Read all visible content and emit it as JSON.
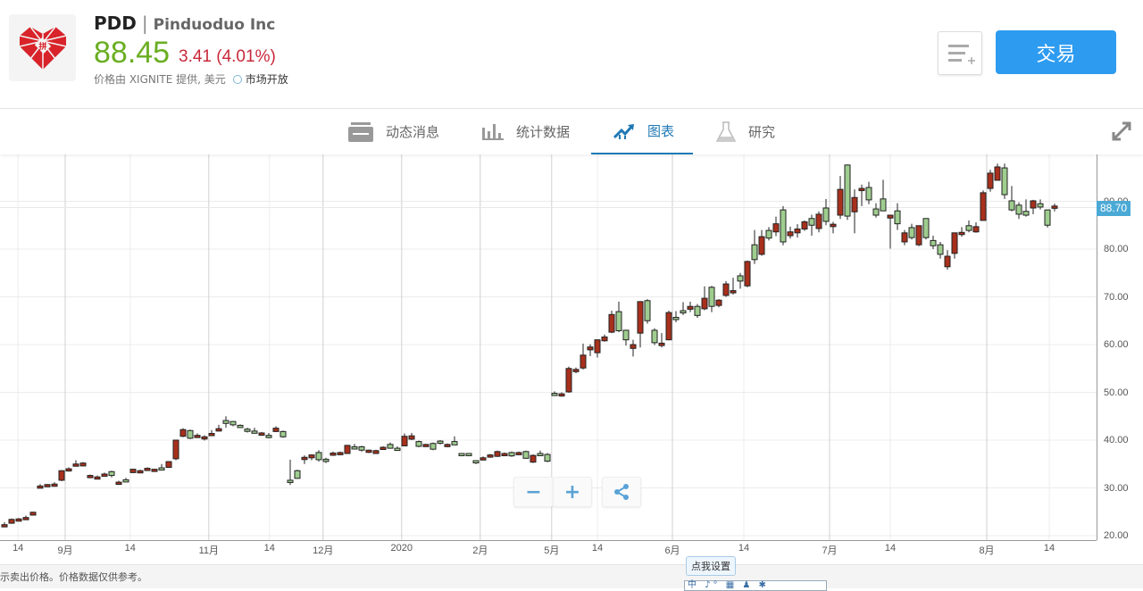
{
  "header": {
    "ticker": "PDD",
    "separator": "|",
    "company": "Pinduoduo Inc",
    "price": "88.45",
    "change": "3.41 (4.01%)",
    "source": "价格由 XIGNITE 提供, 美元",
    "market_status": "市场开放",
    "trade_label": "交易",
    "colors": {
      "price": "#6aae22",
      "change": "#c8283a",
      "trade": "#2d9bf0"
    }
  },
  "tabs": [
    {
      "label": "动态消息",
      "icon": "news-icon"
    },
    {
      "label": "统计数据",
      "icon": "bar-stats-icon"
    },
    {
      "label": "图表",
      "icon": "chart-trend-icon",
      "active": true
    },
    {
      "label": "研究",
      "icon": "flask-icon"
    }
  ],
  "controls": {
    "zoom_out": "−",
    "zoom_in": "+"
  },
  "footer": {
    "disclaimer": "示卖出价格。价格数据仅供参考。",
    "tooltip": "点我设置",
    "ime_toolbar": "中 ♪° ▦ ♟ ✱"
  },
  "chart_data": {
    "type": "candlestick",
    "ylim": [
      20,
      99.4
    ],
    "yticks": [
      "20.00",
      "30.00",
      "40.00",
      "50.00",
      "60.00",
      "70.00",
      "80.00",
      "90.00"
    ],
    "ytick_values": [
      20,
      30,
      40,
      50,
      60,
      70,
      80,
      90
    ],
    "last_price": "88.70",
    "last_price_value": 88.7,
    "xticks": [
      {
        "label": "14",
        "index": 1.9,
        "major": false
      },
      {
        "label": "9月",
        "index": 8.5,
        "major": true
      },
      {
        "label": "14",
        "index": 17.6,
        "major": false
      },
      {
        "label": "11月",
        "index": 28.6,
        "major": true
      },
      {
        "label": "14",
        "index": 37.1,
        "major": false
      },
      {
        "label": "12月",
        "index": 44.6,
        "major": true
      },
      {
        "label": "2020",
        "index": 55.6,
        "major": true
      },
      {
        "label": "2月",
        "index": 66.6,
        "major": true
      },
      {
        "label": "5月",
        "index": 76.6,
        "major": true
      },
      {
        "label": "14",
        "index": 83,
        "major": false
      },
      {
        "label": "6月",
        "index": 93.5,
        "major": true
      },
      {
        "label": "14",
        "index": 103.5,
        "major": false
      },
      {
        "label": "7月",
        "index": 115.5,
        "major": true
      },
      {
        "label": "14",
        "index": 124,
        "major": false
      },
      {
        "label": "8月",
        "index": 137.5,
        "major": true
      },
      {
        "label": "14",
        "index": 146.25,
        "major": false
      }
    ],
    "up_color": "#a8301c",
    "down_color": "#9fcd8f",
    "ohlc": [
      [
        22.0,
        22.8,
        21.8,
        22.3
      ],
      [
        22.6,
        23.6,
        22.5,
        23.4
      ],
      [
        23.2,
        23.7,
        23.0,
        23.5
      ],
      [
        23.5,
        24.2,
        23.4,
        23.8
      ],
      [
        24.3,
        25.0,
        24.2,
        24.9
      ],
      [
        30.1,
        30.8,
        30.0,
        30.4
      ],
      [
        30.5,
        30.8,
        30.4,
        30.7
      ],
      [
        30.5,
        31.2,
        30.4,
        30.8
      ],
      [
        31.6,
        33.7,
        31.4,
        33.6
      ],
      [
        33.6,
        34.3,
        33.4,
        34.0
      ],
      [
        34.6,
        35.8,
        34.5,
        35.0
      ],
      [
        34.6,
        35.4,
        34.5,
        35.2
      ],
      [
        32.3,
        32.8,
        32.2,
        32.6
      ],
      [
        32.0,
        32.6,
        31.9,
        32.3
      ],
      [
        32.6,
        33.2,
        32.5,
        32.9
      ],
      [
        33.4,
        33.6,
        32.2,
        32.6
      ],
      [
        30.8,
        31.5,
        30.7,
        31.2
      ],
      [
        31.7,
        32.1,
        31.3,
        31.4
      ],
      [
        33.2,
        34.0,
        33.1,
        33.9
      ],
      [
        33.2,
        33.8,
        33.1,
        33.6
      ],
      [
        33.9,
        34.3,
        33.8,
        34.1
      ],
      [
        33.7,
        34.0,
        33.6,
        33.9
      ],
      [
        34.2,
        35.0,
        33.9,
        33.9
      ],
      [
        34.3,
        35.6,
        34.2,
        35.5
      ],
      [
        36.1,
        40.1,
        35.8,
        40.0
      ],
      [
        40.8,
        42.5,
        40.6,
        42.2
      ],
      [
        42.0,
        42.2,
        40.2,
        40.4
      ],
      [
        40.6,
        41.4,
        40.5,
        41.0
      ],
      [
        40.4,
        41.0,
        39.9,
        40.7
      ],
      [
        41.1,
        42.1,
        40.9,
        41.4
      ],
      [
        41.9,
        43.2,
        41.8,
        42.4
      ],
      [
        44.1,
        45.0,
        42.6,
        43.5
      ],
      [
        43.9,
        44.0,
        42.9,
        43.2
      ],
      [
        43.1,
        43.3,
        42.7,
        42.9
      ],
      [
        42.3,
        42.6,
        41.6,
        41.9
      ],
      [
        41.9,
        42.6,
        41.4,
        41.6
      ],
      [
        41.2,
        41.7,
        40.9,
        41.5
      ],
      [
        41.0,
        41.5,
        40.4,
        40.9
      ],
      [
        41.8,
        42.9,
        41.7,
        42.5
      ],
      [
        41.8,
        42.0,
        40.5,
        40.7
      ],
      [
        31.6,
        35.9,
        30.6,
        31.2
      ],
      [
        33.6,
        33.8,
        31.9,
        32.0
      ],
      [
        36.1,
        36.8,
        35.0,
        36.4
      ],
      [
        36.3,
        37.0,
        35.8,
        36.9
      ],
      [
        37.4,
        37.9,
        35.5,
        35.9
      ],
      [
        36.0,
        36.3,
        35.2,
        35.7
      ],
      [
        36.9,
        37.6,
        36.7,
        37.3
      ],
      [
        37.2,
        37.6,
        36.9,
        37.4
      ],
      [
        37.2,
        39.0,
        37.1,
        38.9
      ],
      [
        38.6,
        39.2,
        38.1,
        38.3
      ],
      [
        38.6,
        38.8,
        37.6,
        37.9
      ],
      [
        37.6,
        38.0,
        37.3,
        37.9
      ],
      [
        37.2,
        38.0,
        37.1,
        37.8
      ],
      [
        38.2,
        38.7,
        38.0,
        38.5
      ],
      [
        39.1,
        39.5,
        38.2,
        38.3
      ],
      [
        38.3,
        38.7,
        37.8,
        38.0
      ],
      [
        38.8,
        41.4,
        38.7,
        40.8
      ],
      [
        40.2,
        41.5,
        40.0,
        40.9
      ],
      [
        39.7,
        39.9,
        38.5,
        38.7
      ],
      [
        38.9,
        39.2,
        38.6,
        39.1
      ],
      [
        39.3,
        39.5,
        37.9,
        38.1
      ],
      [
        39.8,
        40.0,
        39.1,
        39.5
      ],
      [
        38.8,
        39.3,
        38.5,
        39.1
      ],
      [
        39.7,
        40.8,
        39.0,
        39.0
      ],
      [
        37.2,
        37.3,
        36.8,
        37.0
      ],
      [
        37.2,
        37.3,
        36.8,
        37.0
      ],
      [
        35.7,
        35.8,
        35.0,
        35.4
      ],
      [
        35.9,
        36.6,
        35.8,
        36.3
      ],
      [
        36.5,
        37.1,
        36.3,
        36.9
      ],
      [
        36.6,
        37.8,
        36.5,
        37.6
      ],
      [
        37.0,
        37.4,
        36.9,
        37.2
      ],
      [
        37.4,
        37.6,
        36.5,
        36.7
      ],
      [
        37.0,
        37.6,
        36.9,
        37.4
      ],
      [
        37.6,
        37.8,
        36.1,
        36.2
      ],
      [
        35.4,
        37.0,
        35.2,
        36.8
      ],
      [
        37.2,
        37.8,
        36.9,
        37.0
      ],
      [
        37.0,
        37.3,
        35.4,
        35.6
      ],
      [
        49.8,
        50.2,
        49.3,
        49.6
      ],
      [
        49.3,
        50.0,
        49.1,
        49.7
      ],
      [
        50.1,
        55.4,
        49.9,
        55.0
      ],
      [
        54.4,
        55.2,
        54.0,
        54.8
      ],
      [
        55.1,
        60.2,
        54.8,
        57.8
      ],
      [
        58.9,
        60.1,
        57.6,
        59.5
      ],
      [
        58.3,
        61.1,
        57.3,
        61.0
      ],
      [
        60.8,
        62.1,
        60.6,
        61.6
      ],
      [
        62.6,
        67.1,
        62.4,
        66.3
      ],
      [
        66.9,
        69.0,
        62.6,
        62.9
      ],
      [
        63.0,
        63.1,
        59.8,
        61.0
      ],
      [
        59.2,
        61.0,
        57.5,
        60.0
      ],
      [
        62.4,
        69.1,
        59.4,
        69.0
      ],
      [
        69.2,
        69.5,
        64.4,
        65.0
      ],
      [
        63.0,
        63.4,
        59.9,
        60.4
      ],
      [
        59.8,
        62.4,
        59.4,
        60.3
      ],
      [
        61.0,
        67.1,
        60.9,
        66.7
      ],
      [
        65.7,
        67.0,
        64.7,
        65.3
      ],
      [
        67.1,
        68.9,
        66.2,
        66.7
      ],
      [
        67.4,
        69.0,
        66.8,
        68.0
      ],
      [
        68.0,
        68.5,
        65.6,
        66.1
      ],
      [
        67.5,
        72.2,
        67.2,
        69.7
      ],
      [
        72.0,
        72.3,
        66.8,
        68.0
      ],
      [
        68.2,
        69.5,
        67.8,
        69.3
      ],
      [
        70.3,
        73.3,
        70.0,
        72.7
      ],
      [
        71.0,
        74.0,
        70.5,
        71.3
      ],
      [
        74.4,
        75.0,
        71.7,
        73.3
      ],
      [
        72.3,
        77.6,
        72.0,
        77.4
      ],
      [
        80.9,
        84.0,
        76.9,
        77.8
      ],
      [
        78.9,
        84.0,
        78.6,
        82.6
      ],
      [
        83.9,
        84.6,
        81.8,
        82.3
      ],
      [
        83.6,
        86.8,
        82.7,
        85.3
      ],
      [
        88.2,
        89.0,
        80.8,
        81.5
      ],
      [
        82.8,
        84.7,
        82.2,
        83.6
      ],
      [
        83.4,
        85.2,
        82.4,
        84.2
      ],
      [
        84.2,
        86.0,
        83.8,
        85.7
      ],
      [
        86.4,
        87.2,
        82.8,
        85.0
      ],
      [
        84.3,
        87.9,
        83.5,
        87.3
      ],
      [
        88.6,
        90.5,
        85.0,
        85.8
      ],
      [
        84.7,
        85.7,
        83.3,
        85.2
      ],
      [
        87.1,
        95.3,
        86.3,
        92.5
      ],
      [
        97.6,
        97.7,
        86.1,
        86.9
      ],
      [
        87.8,
        92.5,
        83.3,
        90.8
      ],
      [
        92.4,
        93.5,
        89.0,
        92.7
      ],
      [
        92.9,
        94.1,
        89.4,
        90.3
      ],
      [
        88.4,
        89.6,
        86.6,
        87.1
      ],
      [
        90.5,
        94.5,
        88.0,
        88.0
      ],
      [
        86.5,
        87.1,
        80.1,
        87.1
      ],
      [
        88.0,
        89.6,
        84.0,
        85.3
      ],
      [
        81.5,
        84.0,
        80.8,
        83.4
      ],
      [
        84.5,
        85.3,
        82.0,
        82.4
      ],
      [
        80.9,
        84.9,
        80.6,
        84.9
      ],
      [
        86.4,
        86.4,
        82.0,
        82.4
      ],
      [
        81.8,
        82.8,
        80.0,
        80.7
      ],
      [
        80.9,
        81.5,
        78.0,
        78.9
      ],
      [
        76.3,
        79.8,
        75.7,
        78.5
      ],
      [
        79.1,
        83.4,
        78.0,
        83.4
      ],
      [
        83.2,
        84.6,
        82.6,
        83.5
      ],
      [
        84.9,
        86.0,
        83.5,
        83.9
      ],
      [
        83.6,
        85.6,
        83.4,
        84.7
      ],
      [
        86.0,
        92.3,
        86.0,
        91.8
      ],
      [
        92.7,
        96.6,
        92.0,
        95.9
      ],
      [
        94.4,
        97.9,
        94.4,
        97.2
      ],
      [
        97.0,
        97.9,
        90.5,
        91.4
      ],
      [
        90.1,
        93.2,
        87.9,
        88.2
      ],
      [
        89.2,
        89.8,
        86.3,
        87.3
      ],
      [
        87.9,
        90.4,
        86.8,
        87.1
      ],
      [
        88.6,
        90.3,
        87.3,
        90.1
      ],
      [
        89.5,
        90.4,
        88.3,
        88.8
      ],
      [
        88.2,
        88.2,
        84.5,
        85.0
      ],
      [
        88.6,
        89.5,
        87.9,
        89.0
      ]
    ]
  }
}
